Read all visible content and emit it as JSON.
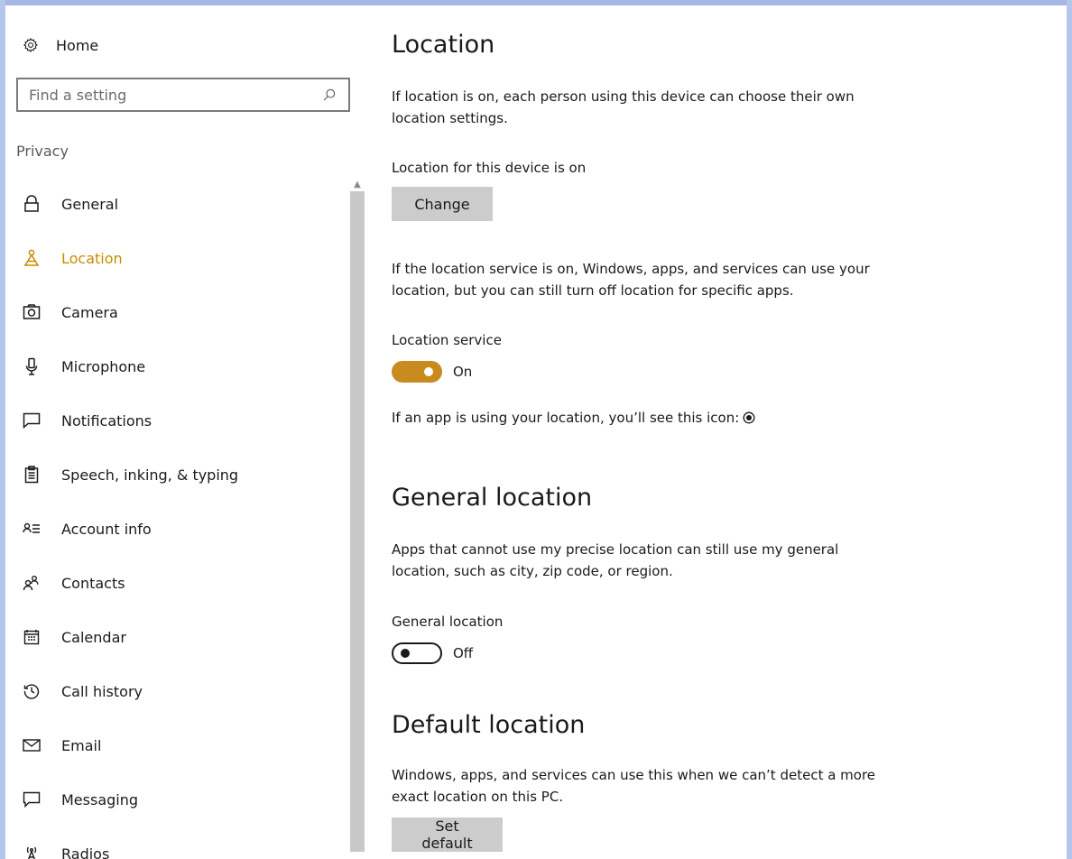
{
  "sidebar": {
    "home_label": "Home",
    "search_placeholder": "Find a setting",
    "section_label": "Privacy",
    "items": [
      {
        "label": "General",
        "icon": "lock-icon",
        "active": false
      },
      {
        "label": "Location",
        "icon": "location-person-icon",
        "active": true
      },
      {
        "label": "Camera",
        "icon": "camera-icon",
        "active": false
      },
      {
        "label": "Microphone",
        "icon": "microphone-icon",
        "active": false
      },
      {
        "label": "Notifications",
        "icon": "notification-icon",
        "active": false
      },
      {
        "label": "Speech, inking, & typing",
        "icon": "clipboard-icon",
        "active": false
      },
      {
        "label": "Account info",
        "icon": "account-info-icon",
        "active": false
      },
      {
        "label": "Contacts",
        "icon": "contacts-icon",
        "active": false
      },
      {
        "label": "Calendar",
        "icon": "calendar-icon",
        "active": false
      },
      {
        "label": "Call history",
        "icon": "history-icon",
        "active": false
      },
      {
        "label": "Email",
        "icon": "mail-icon",
        "active": false
      },
      {
        "label": "Messaging",
        "icon": "message-icon",
        "active": false
      },
      {
        "label": "Radios",
        "icon": "radio-tower-icon",
        "active": false
      }
    ]
  },
  "main": {
    "location": {
      "title": "Location",
      "description": "If location is on, each person using this device can choose their own location settings.",
      "device_status": "Location for this device is on",
      "change_button": "Change",
      "service_description": "If the location service is on, Windows, apps, and services can use your location, but you can still turn off location for specific apps.",
      "service_label": "Location service",
      "service_state": "On",
      "icon_note": "If an app is using your location, you’ll see this icon:"
    },
    "general_location": {
      "title": "General location",
      "description": "Apps that cannot use my precise location can still use my general location, such as city, zip code, or region.",
      "toggle_label": "General location",
      "toggle_state": "Off"
    },
    "default_location": {
      "title": "Default location",
      "description": "Windows, apps, and services can use this when we can’t detect a more exact location on this PC.",
      "button": "Set default"
    }
  },
  "colors": {
    "accent": "#c98b1e",
    "active_nav": "#c98b00",
    "button_bg": "#cccccc",
    "frame_blue": "#b4c6ec"
  }
}
